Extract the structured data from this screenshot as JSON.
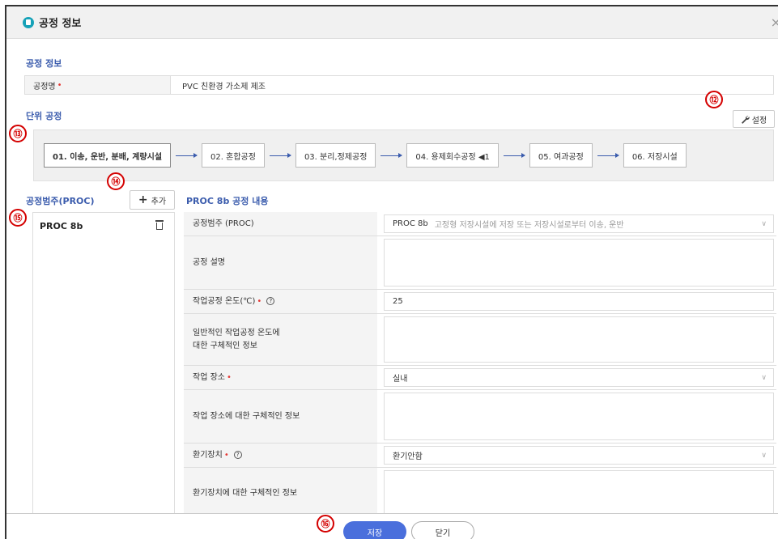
{
  "dialog": {
    "title": "공정 정보",
    "close_glyph": "×"
  },
  "process_info": {
    "section_title": "공정 정보",
    "name_label": "공정명",
    "required_mark": "•",
    "name_value": "PVC 친환경 가소제 제조"
  },
  "unit_process": {
    "section_title": "단위 공정",
    "settings_label": "설정",
    "steps": [
      {
        "label": "01. 이송, 운반, 분배, 계량시설"
      },
      {
        "label": "02. 혼합공정"
      },
      {
        "label": "03. 분리,정제공정"
      },
      {
        "label": "04. 용제회수공정 ◀1"
      },
      {
        "label": "05. 여과공정"
      },
      {
        "label": "06. 저장시설"
      }
    ]
  },
  "proc_category": {
    "section_title": "공정범주(PROC)",
    "add_label": "추가",
    "add_glyph": "+",
    "items": [
      {
        "label": "PROC 8b"
      }
    ]
  },
  "proc_detail": {
    "section_title": "PROC 8b 공정 내용",
    "proc_label": "공정범주 (PROC)",
    "proc_code": "PROC 8b",
    "proc_desc": "고정형 저장시설에 저장 또는 저장시설로부터 이송, 운반",
    "desc_label": "공정 설명",
    "temp_label": "작업공정 온도(℃)",
    "temp_value": "25",
    "temp_detail_line1": "일반적인 작업공정 온도에",
    "temp_detail_line2": "대한 구체적인 정보",
    "place_label": "작업 장소",
    "place_value": "실내",
    "place_detail_label": "작업 장소에 대한 구체적인 정보",
    "vent_label": "환기장치",
    "vent_value": "환기안함",
    "vent_detail_label": "환기장치에 대한 구체적인 정보",
    "help_glyph": "?"
  },
  "footer": {
    "save_label": "저장",
    "close_label": "닫기"
  },
  "callouts": {
    "c12": "⑫",
    "c13": "⑬",
    "c14": "⑭",
    "c15": "⑮",
    "c16": "⑯"
  },
  "icons": {
    "title": "document-icon",
    "settings": "wrench-icon",
    "delete": "trash-icon",
    "add": "plus-icon"
  },
  "colors": {
    "accent": "#3b5cad",
    "primary_button": "#4a6fdc",
    "required": "#e53935",
    "callout": "#d40000"
  }
}
